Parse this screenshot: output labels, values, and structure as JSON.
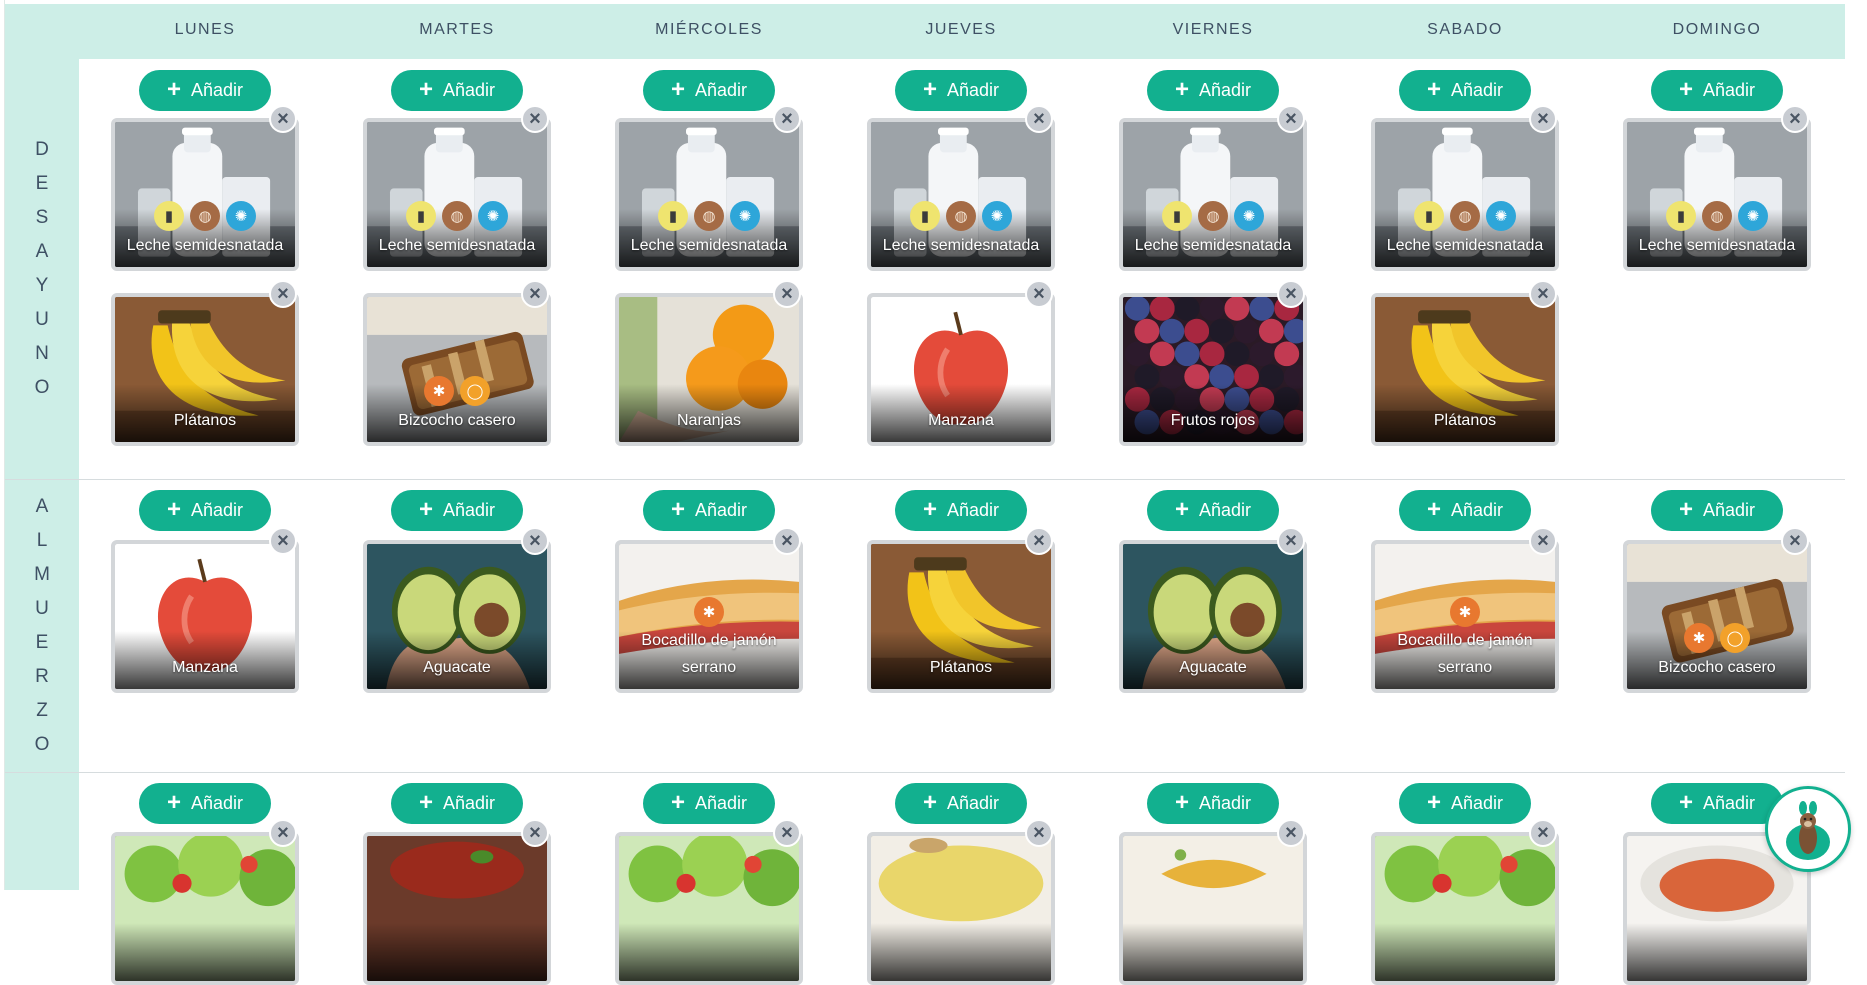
{
  "days": [
    "LUNES",
    "MARTES",
    "MIÉRCOLES",
    "JUEVES",
    "VIERNES",
    "SABADO",
    "DOMINGO"
  ],
  "add_label": "Añadir",
  "close_glyph": "×",
  "colors": {
    "header_bg": "#cdeee7",
    "accent": "#12b08f",
    "text": "#3e5064"
  },
  "allergen_icons": {
    "milk": "milk-bottle-icon",
    "nuts": "peanut-icon",
    "shell": "shellfish-icon",
    "gluten": "wheat-icon",
    "egg": "egg-icon"
  },
  "meals": [
    {
      "letters": [
        "D",
        "E",
        "S",
        "A",
        "Y",
        "U",
        "N",
        "O"
      ],
      "columns": [
        [
          {
            "name": "Leche semidesnatada",
            "image": "milk",
            "allergens": [
              "milk",
              "nuts",
              "shell"
            ]
          },
          {
            "name": "Plátanos",
            "image": "banana",
            "allergens": []
          }
        ],
        [
          {
            "name": "Leche semidesnatada",
            "image": "milk",
            "allergens": [
              "milk",
              "nuts",
              "shell"
            ]
          },
          {
            "name": "Bizcocho casero",
            "image": "cake",
            "allergens": [
              "gluten",
              "egg"
            ]
          }
        ],
        [
          {
            "name": "Leche semidesnatada",
            "image": "milk",
            "allergens": [
              "milk",
              "nuts",
              "shell"
            ]
          },
          {
            "name": "Naranjas",
            "image": "orange",
            "allergens": []
          }
        ],
        [
          {
            "name": "Leche semidesnatada",
            "image": "milk",
            "allergens": [
              "milk",
              "nuts",
              "shell"
            ]
          },
          {
            "name": "Manzana",
            "image": "apple",
            "allergens": []
          }
        ],
        [
          {
            "name": "Leche semidesnatada",
            "image": "milk",
            "allergens": [
              "milk",
              "nuts",
              "shell"
            ]
          },
          {
            "name": "Frutos rojos",
            "image": "berries",
            "allergens": []
          }
        ],
        [
          {
            "name": "Leche semidesnatada",
            "image": "milk",
            "allergens": [
              "milk",
              "nuts",
              "shell"
            ]
          },
          {
            "name": "Plátanos",
            "image": "banana",
            "allergens": []
          }
        ],
        [
          {
            "name": "Leche semidesnatada",
            "image": "milk",
            "allergens": [
              "milk",
              "nuts",
              "shell"
            ]
          }
        ]
      ]
    },
    {
      "letters": [
        "A",
        "L",
        "M",
        "U",
        "E",
        "R",
        "Z",
        "O"
      ],
      "columns": [
        [
          {
            "name": "Manzana",
            "image": "apple",
            "allergens": []
          }
        ],
        [
          {
            "name": "Aguacate",
            "image": "avocado",
            "allergens": []
          }
        ],
        [
          {
            "name": "Bocadillo de jamón serrano",
            "image": "sandwich",
            "allergens": [
              "gluten"
            ]
          }
        ],
        [
          {
            "name": "Plátanos",
            "image": "banana",
            "allergens": []
          }
        ],
        [
          {
            "name": "Aguacate",
            "image": "avocado",
            "allergens": []
          }
        ],
        [
          {
            "name": "Bocadillo de jamón serrano",
            "image": "sandwich",
            "allergens": [
              "gluten"
            ]
          }
        ],
        [
          {
            "name": "Bizcocho casero",
            "image": "cake",
            "allergens": [
              "gluten",
              "egg"
            ]
          }
        ]
      ]
    },
    {
      "letters": [],
      "columns": [
        [
          {
            "name": "",
            "image": "salad",
            "allergens": []
          }
        ],
        [
          {
            "name": "",
            "image": "jam",
            "allergens": []
          }
        ],
        [
          {
            "name": "",
            "image": "salad",
            "allergens": []
          }
        ],
        [
          {
            "name": "",
            "image": "soup",
            "allergens": []
          }
        ],
        [
          {
            "name": "",
            "image": "pasta",
            "allergens": []
          }
        ],
        [
          {
            "name": "",
            "image": "salad",
            "allergens": []
          }
        ],
        [
          {
            "name": "",
            "image": "stew",
            "allergens": []
          }
        ]
      ]
    }
  ],
  "chat_assistant_icon": "otter-mascot-icon"
}
